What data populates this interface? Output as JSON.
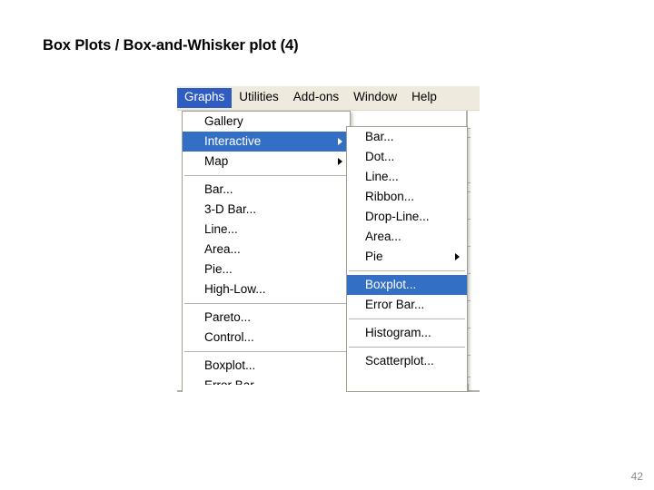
{
  "slide": {
    "title": "Box Plots / Box-and-Whisker plot (4)",
    "page_number": "42"
  },
  "app": {
    "menubar": {
      "items": [
        {
          "label": "Graphs",
          "state": "active"
        },
        {
          "label": "Utilities",
          "state": "normal"
        },
        {
          "label": "Add-ons",
          "state": "normal"
        },
        {
          "label": "Window",
          "state": "normal"
        },
        {
          "label": "Help",
          "state": "normal"
        }
      ]
    },
    "graphs_menu": {
      "items": [
        {
          "label": "Gallery",
          "state": "normal",
          "submenu": false
        },
        {
          "label": "Interactive",
          "state": "selected",
          "submenu": true
        },
        {
          "label": "Map",
          "state": "normal",
          "submenu": true
        },
        {
          "label": "Bar...",
          "state": "normal",
          "submenu": false
        },
        {
          "label": "3-D Bar...",
          "state": "normal",
          "submenu": false
        },
        {
          "label": "Line...",
          "state": "normal",
          "submenu": false
        },
        {
          "label": "Area...",
          "state": "normal",
          "submenu": false
        },
        {
          "label": "Pie...",
          "state": "normal",
          "submenu": false
        },
        {
          "label": "High-Low...",
          "state": "normal",
          "submenu": false
        },
        {
          "label": "Pareto...",
          "state": "normal",
          "submenu": false
        },
        {
          "label": "Control...",
          "state": "normal",
          "submenu": false
        },
        {
          "label": "Boxplot...",
          "state": "normal",
          "submenu": false
        },
        {
          "label": "Error Bar...",
          "state": "clipped",
          "submenu": false
        }
      ]
    },
    "interactive_submenu": {
      "items": [
        {
          "label": "Bar...",
          "state": "normal",
          "submenu": false
        },
        {
          "label": "Dot...",
          "state": "normal",
          "submenu": false
        },
        {
          "label": "Line...",
          "state": "normal",
          "submenu": false
        },
        {
          "label": "Ribbon...",
          "state": "normal",
          "submenu": false
        },
        {
          "label": "Drop-Line...",
          "state": "normal",
          "submenu": false
        },
        {
          "label": "Area...",
          "state": "normal",
          "submenu": false
        },
        {
          "label": "Pie",
          "state": "normal",
          "submenu": true
        },
        {
          "label": "Boxplot...",
          "state": "selected",
          "submenu": false
        },
        {
          "label": "Error Bar...",
          "state": "normal",
          "submenu": false
        },
        {
          "label": "Histogram...",
          "state": "normal",
          "submenu": false
        },
        {
          "label": "Scatterplot...",
          "state": "normal",
          "submenu": false
        }
      ]
    },
    "background": {
      "partial_value": "0"
    },
    "colors": {
      "menubar_background": "#eeeade",
      "menubar_active": "#2f5cc0",
      "menu_highlight": "#3370c5",
      "menu_background": "#ffffff",
      "page_number": "#8c8c8c"
    }
  }
}
